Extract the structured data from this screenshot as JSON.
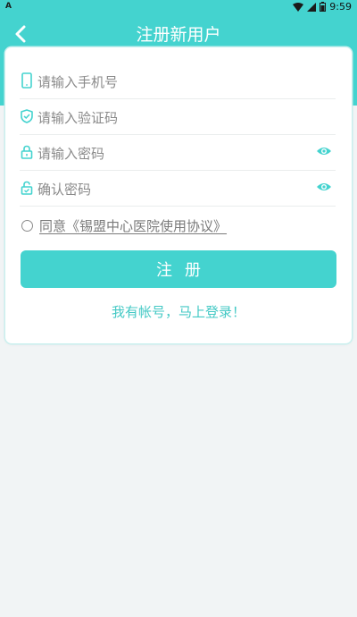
{
  "status_bar": {
    "left_indicator": "A",
    "time": "9:59"
  },
  "header": {
    "title": "注册新用户"
  },
  "form": {
    "phone_placeholder": "请输入手机号",
    "code_placeholder": "请输入验证码",
    "password_placeholder": "请输入密码",
    "confirm_placeholder": "确认密码",
    "agreement_label": "同意《锡盟中心医院使用协议》",
    "submit_label": "注册",
    "login_link": "我有帐号，马上登录！"
  },
  "colors": {
    "accent": "#44d3cf",
    "background": "#f1f4f5",
    "placeholder": "#8a8a8a"
  },
  "icons": [
    "back-arrow-icon",
    "phone-icon",
    "shield-check-icon",
    "lock-icon",
    "lock-check-icon",
    "eye-icon",
    "wifi-icon",
    "signal-icon",
    "battery-icon"
  ]
}
